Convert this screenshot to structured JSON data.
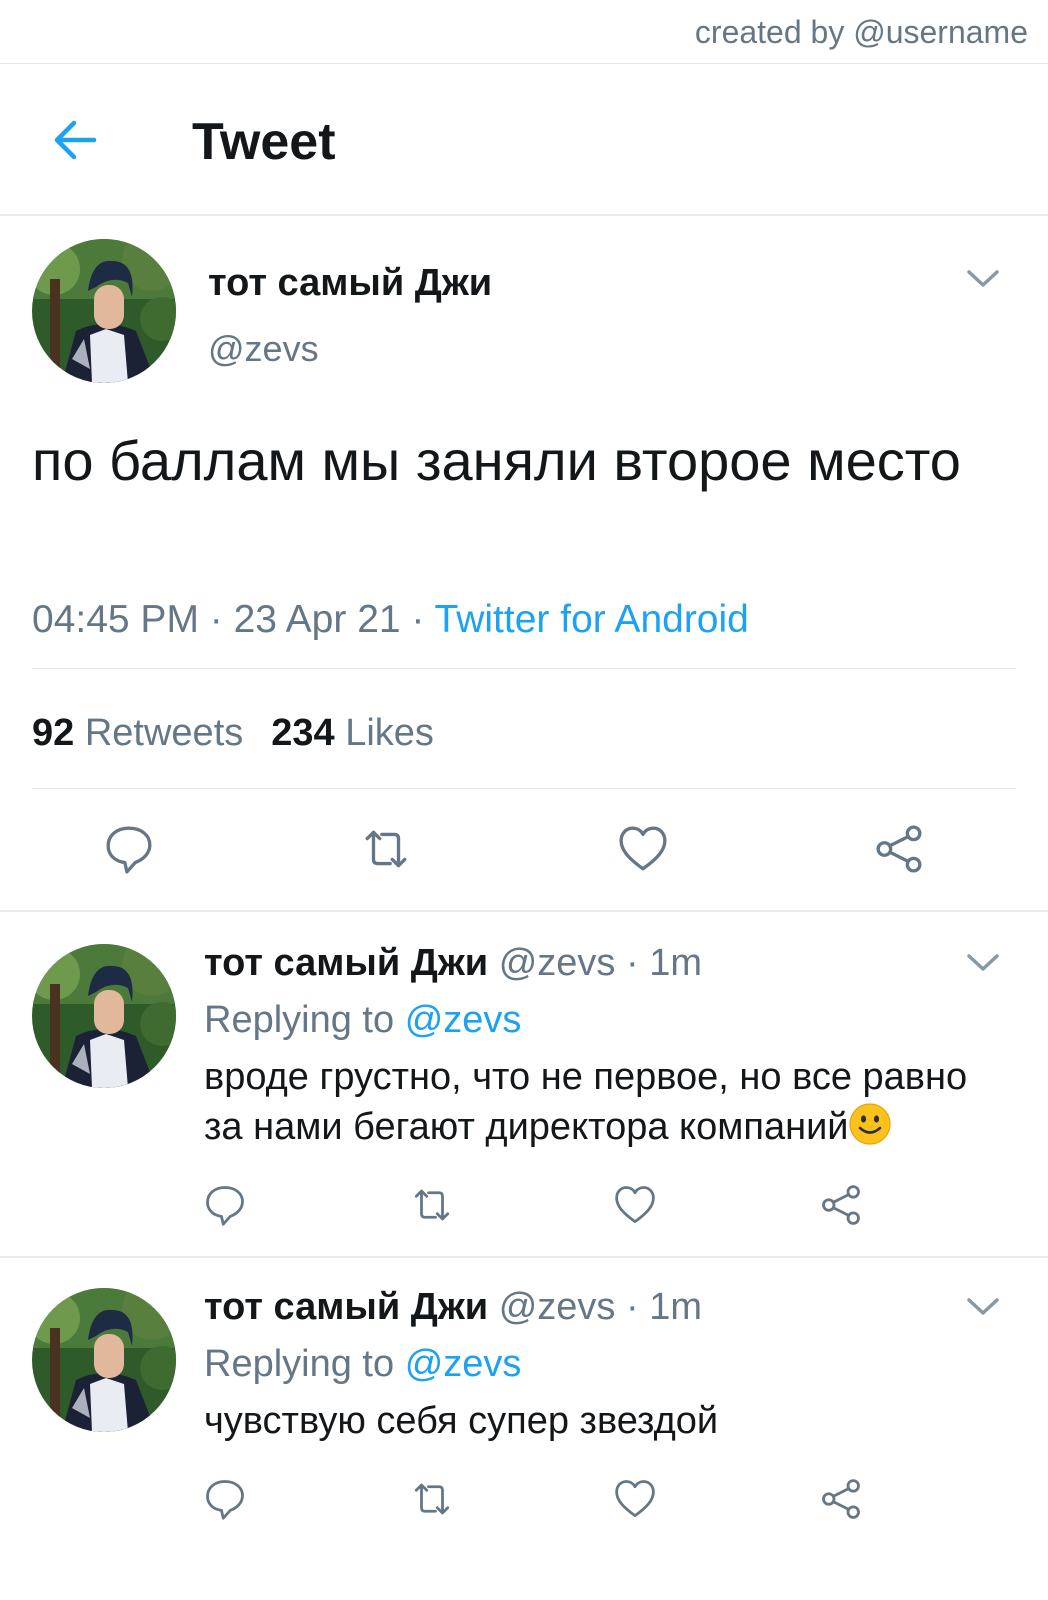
{
  "credit": "created by @username",
  "header": {
    "title": "Tweet"
  },
  "tweet": {
    "name": "тот самый Джи",
    "handle": "@zevs",
    "text": "по баллам мы заняли второе место",
    "time": "04:45 PM",
    "date": "23 Apr 21",
    "source": "Twitter for Android",
    "retweets": "92",
    "retweets_label": "Retweets",
    "likes": "234",
    "likes_label": "Likes"
  },
  "replies": [
    {
      "name": "тот самый Джи",
      "handle": "@zevs",
      "time": "1m",
      "replying_label": "Replying to",
      "replying_to": "@zevs",
      "text": "вроде грустно, что не первое, но все равно за нами бегают директора компаний",
      "emoji": "slightly-smiling-face"
    },
    {
      "name": "тот самый Джи",
      "handle": "@zevs",
      "time": "1m",
      "replying_label": "Replying to",
      "replying_to": "@zevs",
      "text": "чувствую себя супер звездой"
    }
  ],
  "icons": {
    "back": "arrow-left-icon",
    "menu": "chevron-down-icon",
    "reply": "speech-bubble-icon",
    "retweet": "retweet-icon",
    "like": "heart-icon",
    "share": "share-icon"
  },
  "colors": {
    "accent": "#1da1f2",
    "text": "#14171a",
    "secondary": "#657786",
    "divider": "#e6ecf0"
  }
}
